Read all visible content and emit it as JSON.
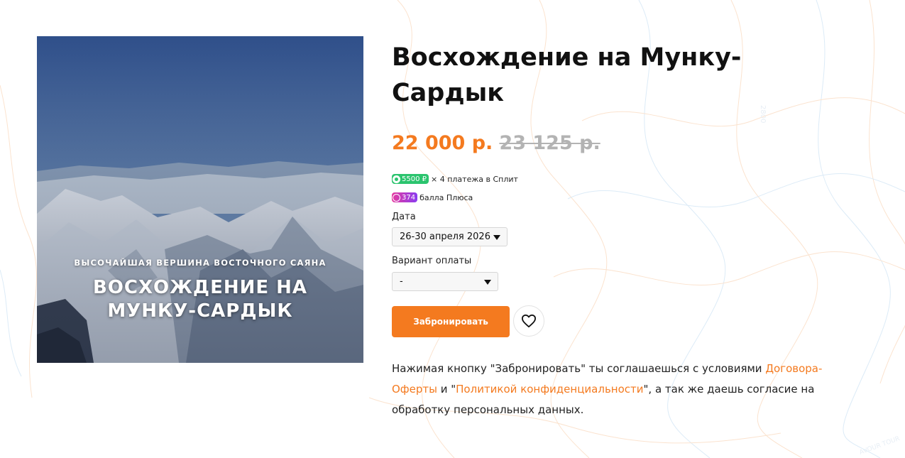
{
  "hero": {
    "subtitle": "Высочайшая вершина Восточного Саяна",
    "title_line1": "Восхождение на",
    "title_line2": "Мунку-Сардык"
  },
  "product": {
    "title": "Восхождение на Мунку-Сардык",
    "price": "22 000 р.",
    "old_price": "23 125 р."
  },
  "split": {
    "amount": "5500 ₽",
    "text": "× 4 платежа в Сплит"
  },
  "plus": {
    "points": "374",
    "text": "балла Плюса"
  },
  "date_field": {
    "label": "Дата",
    "value": "26-30 апреля 2026"
  },
  "payment_field": {
    "label": "Вариант оплаты",
    "value": "-"
  },
  "actions": {
    "book_label": "Забронировать"
  },
  "consent": {
    "part1": "Нажимая кнопку \"Забронировать\" ты соглашаешься с условиями ",
    "offer_link": "Договора-Оферты",
    "part2": " и \"",
    "privacy_link": "Политикой конфиденциальности",
    "part3": "\", а так же даешь согласие на обработку персональных данных."
  },
  "background": {
    "topo_label_1": "2800",
    "topo_label_2": "AVOUR TOUR"
  },
  "colors": {
    "accent": "#f47a1f",
    "old_price": "#b3b3b3",
    "split_green": "#2bc46e",
    "plus_gradient_start": "#e43ba0",
    "plus_gradient_end": "#8a3cf0"
  },
  "icons": {
    "favorite": "heart-icon",
    "select_caret": "caret-down-icon",
    "split": "split-icon",
    "plus": "plus-icon"
  }
}
